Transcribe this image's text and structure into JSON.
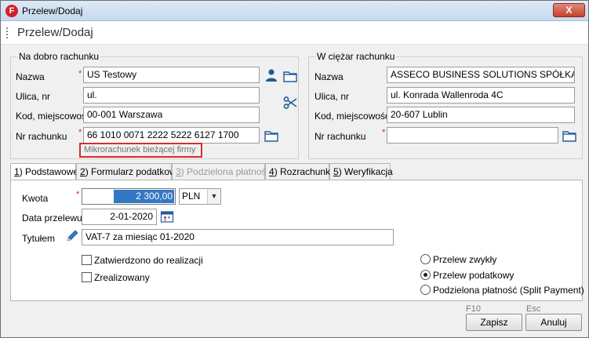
{
  "window": {
    "title": "Przelew/Dodaj",
    "close_label": "X",
    "app_icon_letter": "F"
  },
  "header": {
    "title": "Przelew/Dodaj"
  },
  "credit": {
    "legend": "Na dobro rachunku",
    "name_label": "Nazwa",
    "name_value": "US Testowy",
    "street_label": "Ulica, nr",
    "street_value": "ul.",
    "postal_label": "Kod, miejscowość",
    "postal_value": "00-001 Warszawa",
    "account_label": "Nr rachunku",
    "account_value": "66 1010 0071 2222 5222 6127 1700",
    "subaccount_hint": "Mikrorachunek bieżącej firmy"
  },
  "debit": {
    "legend": "W ciężar rachunku",
    "name_label": "Nazwa",
    "name_value": "ASSECO BUSINESS SOLUTIONS SPÓŁKA AKC",
    "street_label": "Ulica, nr",
    "street_value": "ul. Konrada Wallenroda 4C",
    "postal_label": "Kod, miejscowość",
    "postal_value": "20-607 Lublin",
    "account_label": "Nr rachunku",
    "account_value": ""
  },
  "tabs": [
    {
      "key": "1",
      "label": ") Podstawowe"
    },
    {
      "key": "2",
      "label": ") Formularz podatkowy"
    },
    {
      "key": "3",
      "label": ") Podzielona płatność"
    },
    {
      "key": "4",
      "label": ") Rozrachunki"
    },
    {
      "key": "5",
      "label": ") Weryfikacja"
    }
  ],
  "basic": {
    "amount_label": "Kwota",
    "amount_value": "2 300,00",
    "currency_value": "PLN",
    "date_label": "Data przelewu",
    "date_value": "2-01-2020",
    "title_label": "Tytułem",
    "title_value": "VAT-7 za miesiąc 01-2020",
    "approved_label": "Zatwierdzono do realizacji",
    "realized_label": "Zrealizowany",
    "radio_standard": "Przelew zwykły",
    "radio_tax": "Przelew podatkowy",
    "radio_split": "Podzielona płatność (Split Payment)"
  },
  "footer": {
    "save_hotkey": "F10",
    "save_label": "Zapisz",
    "cancel_hotkey": "Esc",
    "cancel_label": "Anuluj"
  }
}
